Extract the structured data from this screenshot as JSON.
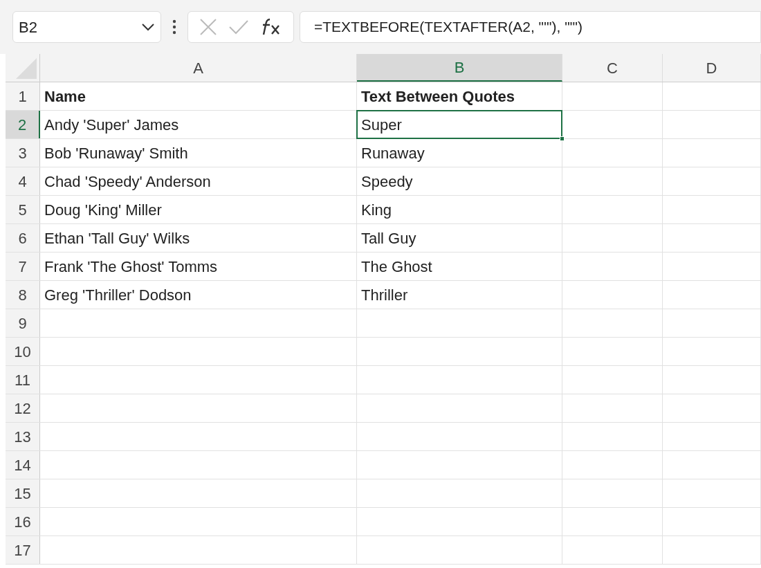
{
  "name_box": {
    "value": "B2"
  },
  "formula_bar": {
    "value": "=TEXTBEFORE(TEXTAFTER(A2, \"'\"), \"'\")"
  },
  "columns": [
    {
      "label": "A",
      "selected": false
    },
    {
      "label": "B",
      "selected": true
    },
    {
      "label": "C",
      "selected": false
    },
    {
      "label": "D",
      "selected": false
    }
  ],
  "rows": [
    {
      "number": "1",
      "selected": false,
      "cells": [
        {
          "text": "Name",
          "bold": true,
          "selected": false
        },
        {
          "text": "Text Between Quotes",
          "bold": true,
          "selected": false
        }
      ]
    },
    {
      "number": "2",
      "selected": true,
      "cells": [
        {
          "text": "Andy 'Super' James",
          "bold": false,
          "selected": false
        },
        {
          "text": "Super",
          "bold": false,
          "selected": true
        }
      ]
    },
    {
      "number": "3",
      "selected": false,
      "cells": [
        {
          "text": "Bob 'Runaway' Smith",
          "bold": false,
          "selected": false
        },
        {
          "text": "Runaway",
          "bold": false,
          "selected": false
        }
      ]
    },
    {
      "number": "4",
      "selected": false,
      "cells": [
        {
          "text": "Chad 'Speedy' Anderson",
          "bold": false,
          "selected": false
        },
        {
          "text": "Speedy",
          "bold": false,
          "selected": false
        }
      ]
    },
    {
      "number": "5",
      "selected": false,
      "cells": [
        {
          "text": "Doug 'King' Miller",
          "bold": false,
          "selected": false
        },
        {
          "text": "King",
          "bold": false,
          "selected": false
        }
      ]
    },
    {
      "number": "6",
      "selected": false,
      "cells": [
        {
          "text": "Ethan 'Tall Guy' Wilks",
          "bold": false,
          "selected": false
        },
        {
          "text": "Tall Guy",
          "bold": false,
          "selected": false
        }
      ]
    },
    {
      "number": "7",
      "selected": false,
      "cells": [
        {
          "text": "Frank 'The Ghost' Tomms",
          "bold": false,
          "selected": false
        },
        {
          "text": "The Ghost",
          "bold": false,
          "selected": false
        }
      ]
    },
    {
      "number": "8",
      "selected": false,
      "cells": [
        {
          "text": "Greg 'Thriller' Dodson",
          "bold": false,
          "selected": false
        },
        {
          "text": "Thriller",
          "bold": false,
          "selected": false
        }
      ]
    },
    {
      "number": "9",
      "selected": false
    },
    {
      "number": "10",
      "selected": false
    },
    {
      "number": "11",
      "selected": false
    },
    {
      "number": "12",
      "selected": false
    },
    {
      "number": "13",
      "selected": false
    },
    {
      "number": "14",
      "selected": false
    },
    {
      "number": "15",
      "selected": false
    },
    {
      "number": "16",
      "selected": false
    },
    {
      "number": "17",
      "selected": false
    }
  ]
}
